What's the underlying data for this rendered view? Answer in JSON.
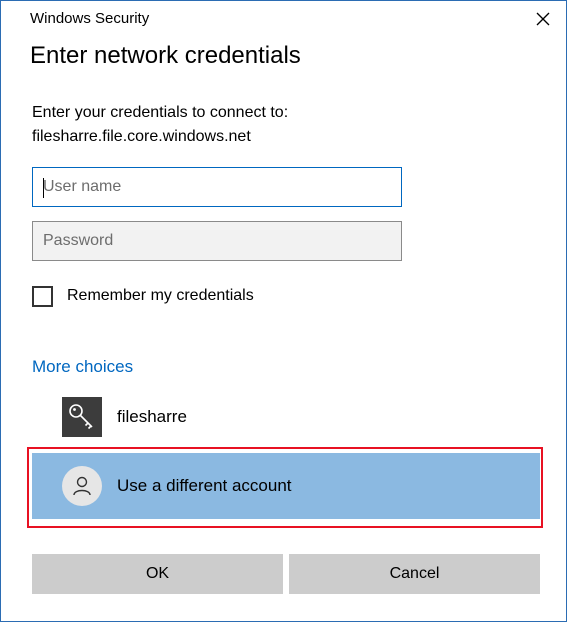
{
  "window": {
    "title": "Windows Security",
    "close_icon": "close-icon"
  },
  "dialog": {
    "heading": "Enter network credentials",
    "prompt_line1": "Enter your credentials to connect to:",
    "prompt_line2": "filesharre.file.core.windows.net"
  },
  "form": {
    "username": {
      "value": "",
      "placeholder": "User name"
    },
    "password": {
      "value": "",
      "placeholder": "Password"
    },
    "remember": {
      "label": "Remember my credentials",
      "checked": false
    }
  },
  "more_choices": {
    "label": "More choices",
    "accounts": [
      {
        "label": "filesharre",
        "icon": "key-icon"
      },
      {
        "label": "Use a different account",
        "icon": "user-icon",
        "selected": true
      }
    ]
  },
  "buttons": {
    "ok": "OK",
    "cancel": "Cancel"
  },
  "colors": {
    "accent": "#0067c0",
    "selected_bg": "#8bb9e1",
    "highlight": "#e81123",
    "button_bg": "#cccccc"
  }
}
